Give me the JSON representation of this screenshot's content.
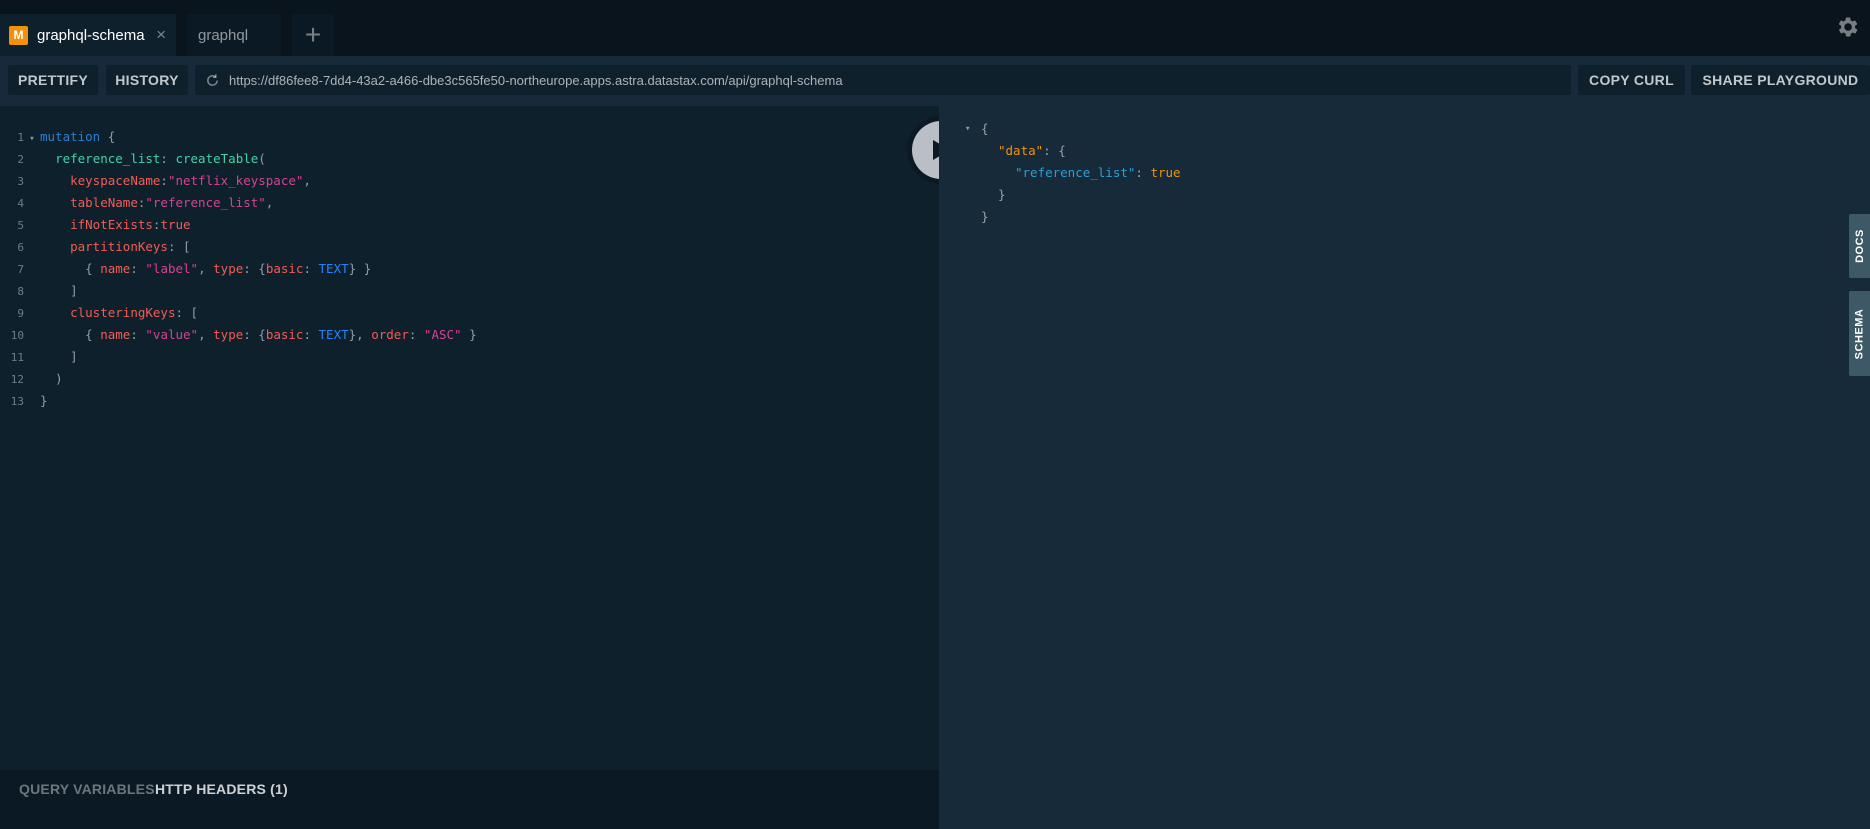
{
  "tabs": [
    {
      "badge": "M",
      "label": "graphql-schema",
      "close": "×",
      "active": true
    },
    {
      "label": "graphql",
      "active": false
    }
  ],
  "tab_add": "+",
  "icons": {
    "settings": "gear-icon",
    "reload": "reload-icon",
    "play": "play-icon"
  },
  "toolbar": {
    "prettify": "PRETTIFY",
    "history": "HISTORY",
    "url": "https://df86fee8-7dd4-43a2-a466-dbe3c565fe50-northeurope.apps.astra.datastax.com/api/graphql-schema",
    "copy_curl": "COPY CURL",
    "share": "SHARE PLAYGROUND"
  },
  "editor": {
    "lines": [
      {
        "n": "1",
        "fold": true,
        "tokens": [
          {
            "t": "mutation",
            "c": "k-kw"
          },
          {
            "t": " {",
            "c": "k-punc"
          }
        ]
      },
      {
        "n": "2",
        "tokens": [
          {
            "t": "  "
          },
          {
            "t": "reference_list",
            "c": "k-def"
          },
          {
            "t": ": ",
            "c": "k-punc"
          },
          {
            "t": "createTable",
            "c": "k-fn"
          },
          {
            "t": "(",
            "c": "k-punc"
          }
        ]
      },
      {
        "n": "3",
        "tokens": [
          {
            "t": "    "
          },
          {
            "t": "keyspaceName",
            "c": "k-attr"
          },
          {
            "t": ":",
            "c": "k-punc"
          },
          {
            "t": "\"netflix_keyspace\"",
            "c": "k-str"
          },
          {
            "t": ",",
            "c": "k-punc"
          }
        ]
      },
      {
        "n": "4",
        "tokens": [
          {
            "t": "    "
          },
          {
            "t": "tableName",
            "c": "k-attr"
          },
          {
            "t": ":",
            "c": "k-punc"
          },
          {
            "t": "\"reference_list\"",
            "c": "k-str"
          },
          {
            "t": ",",
            "c": "k-punc"
          }
        ]
      },
      {
        "n": "5",
        "tokens": [
          {
            "t": "    "
          },
          {
            "t": "ifNotExists",
            "c": "k-attr"
          },
          {
            "t": ":",
            "c": "k-punc"
          },
          {
            "t": "true",
            "c": "k-bool"
          }
        ]
      },
      {
        "n": "6",
        "tokens": [
          {
            "t": "    "
          },
          {
            "t": "partitionKeys",
            "c": "k-attr"
          },
          {
            "t": ": [",
            "c": "k-punc"
          }
        ]
      },
      {
        "n": "7",
        "tokens": [
          {
            "t": "      "
          },
          {
            "t": "{ ",
            "c": "k-punc"
          },
          {
            "t": "name",
            "c": "k-attr"
          },
          {
            "t": ": ",
            "c": "k-punc"
          },
          {
            "t": "\"label\"",
            "c": "k-str"
          },
          {
            "t": ", ",
            "c": "k-punc"
          },
          {
            "t": "type",
            "c": "k-attr"
          },
          {
            "t": ": {",
            "c": "k-punc"
          },
          {
            "t": "basic",
            "c": "k-attr"
          },
          {
            "t": ": ",
            "c": "k-punc"
          },
          {
            "t": "TEXT",
            "c": "k-enum"
          },
          {
            "t": "} }",
            "c": "k-punc"
          }
        ]
      },
      {
        "n": "8",
        "tokens": [
          {
            "t": "    "
          },
          {
            "t": "]",
            "c": "k-punc"
          }
        ]
      },
      {
        "n": "9",
        "tokens": [
          {
            "t": "    "
          },
          {
            "t": "clusteringKeys",
            "c": "k-attr"
          },
          {
            "t": ": [",
            "c": "k-punc"
          }
        ]
      },
      {
        "n": "10",
        "tokens": [
          {
            "t": "      "
          },
          {
            "t": "{ ",
            "c": "k-punc"
          },
          {
            "t": "name",
            "c": "k-attr"
          },
          {
            "t": ": ",
            "c": "k-punc"
          },
          {
            "t": "\"value\"",
            "c": "k-str"
          },
          {
            "t": ", ",
            "c": "k-punc"
          },
          {
            "t": "type",
            "c": "k-attr"
          },
          {
            "t": ": {",
            "c": "k-punc"
          },
          {
            "t": "basic",
            "c": "k-attr"
          },
          {
            "t": ": ",
            "c": "k-punc"
          },
          {
            "t": "TEXT",
            "c": "k-enum"
          },
          {
            "t": "}, ",
            "c": "k-punc"
          },
          {
            "t": "order",
            "c": "k-attr"
          },
          {
            "t": ": ",
            "c": "k-punc"
          },
          {
            "t": "\"ASC\"",
            "c": "k-str"
          },
          {
            "t": " }",
            "c": "k-punc"
          }
        ]
      },
      {
        "n": "11",
        "tokens": [
          {
            "t": "    "
          },
          {
            "t": "]",
            "c": "k-punc"
          }
        ]
      },
      {
        "n": "12",
        "tokens": [
          {
            "t": "  "
          },
          {
            "t": ")",
            "c": "k-punc"
          }
        ]
      },
      {
        "n": "13",
        "tokens": [
          {
            "t": "}",
            "c": "k-punc"
          }
        ]
      }
    ]
  },
  "bottom_tabs": {
    "query_variables": "QUERY VARIABLES",
    "http_headers": "HTTP HEADERS (1)"
  },
  "result": {
    "lines": [
      {
        "indent": 0,
        "fold": true,
        "tokens": [
          {
            "t": "{",
            "c": "r-punc"
          }
        ]
      },
      {
        "indent": 1,
        "tokens": [
          {
            "t": "\"data\"",
            "c": "r-key-a"
          },
          {
            "t": ": {",
            "c": "r-punc"
          }
        ]
      },
      {
        "indent": 2,
        "tokens": [
          {
            "t": "\"reference_list\"",
            "c": "r-key-b"
          },
          {
            "t": ": ",
            "c": "r-punc"
          },
          {
            "t": "true",
            "c": "r-bool"
          }
        ]
      },
      {
        "indent": 1,
        "tokens": [
          {
            "t": "}",
            "c": "r-punc"
          }
        ]
      },
      {
        "indent": 0,
        "tokens": [
          {
            "t": "}",
            "c": "r-punc"
          }
        ]
      }
    ]
  },
  "side_tabs": {
    "docs": "DOCS",
    "schema": "SCHEMA"
  }
}
